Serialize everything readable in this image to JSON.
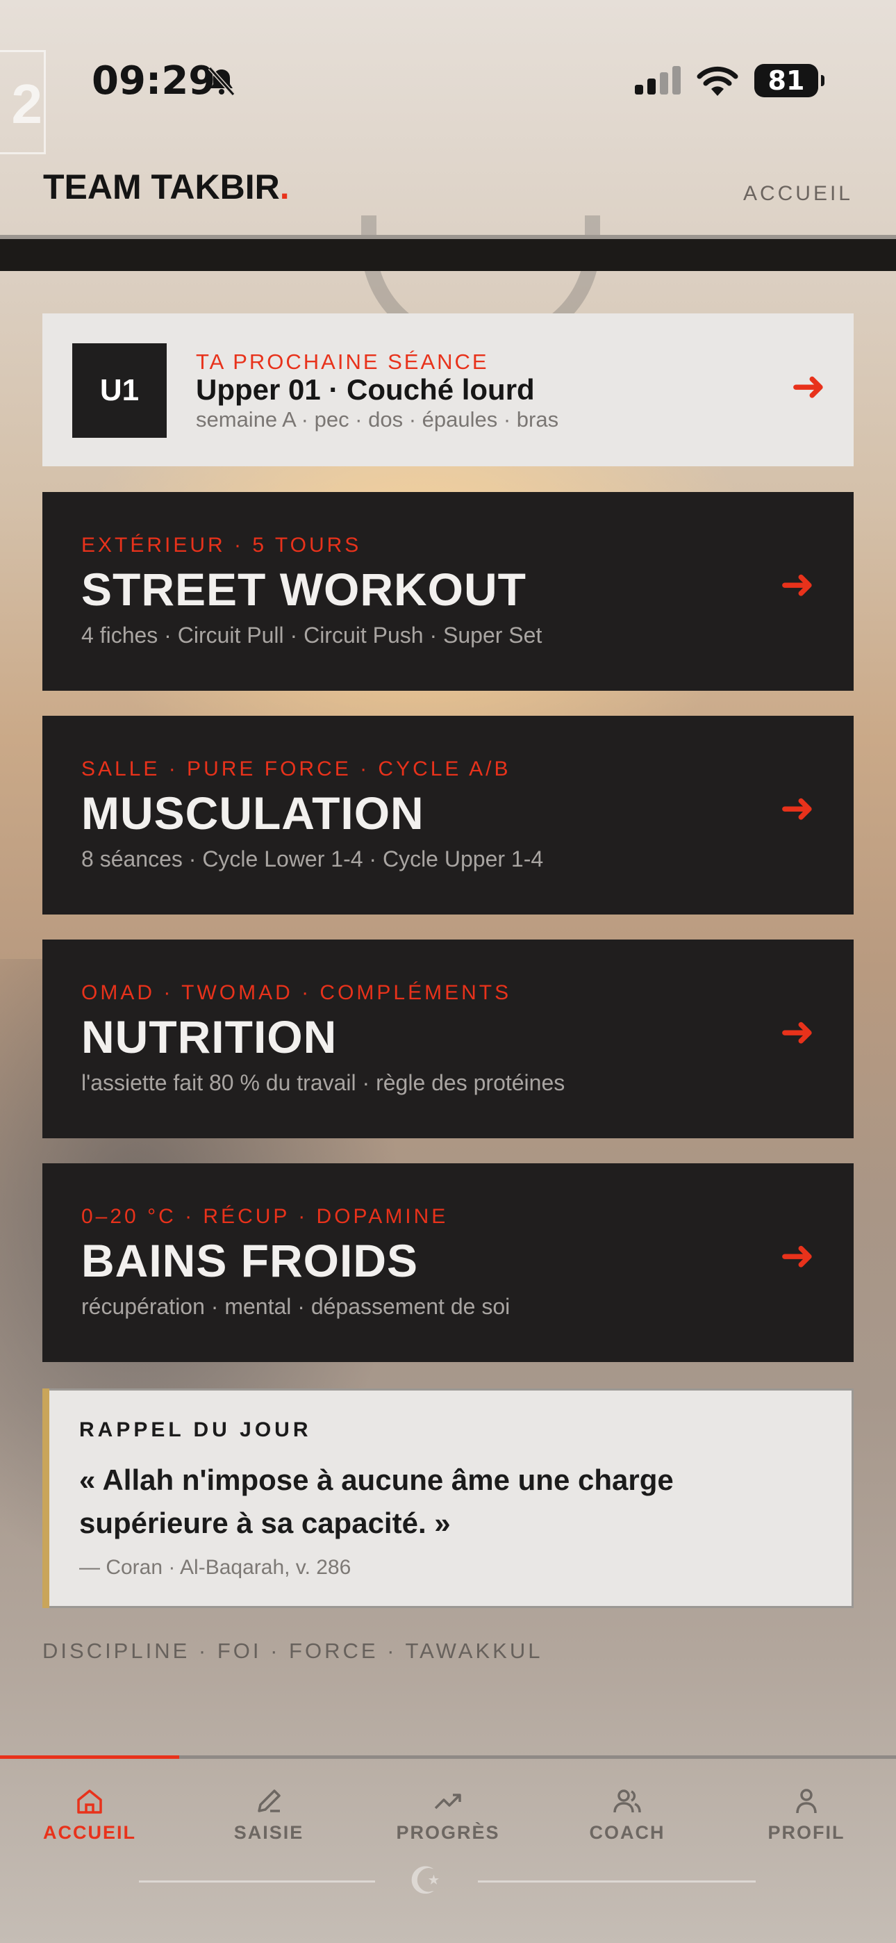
{
  "status_bar": {
    "time": "09:29",
    "battery": "81"
  },
  "background": {
    "side_number": "2"
  },
  "header": {
    "brand": "TEAM TAKBIR",
    "brand_dot": ".",
    "nav": "ACCUEIL"
  },
  "next_session": {
    "badge": "U1",
    "kicker": "TA PROCHAINE SÉANCE",
    "title": "Upper 01 · Couché lourd",
    "subtitle": "semaine A · pec · dos · épaules · bras",
    "arrow": "➜"
  },
  "cards": [
    {
      "kicker": "EXTÉRIEUR · 5 TOURS",
      "title": "STREET WORKOUT",
      "subtitle": "4 fiches · Circuit Pull · Circuit Push · Super Set",
      "arrow": "➜"
    },
    {
      "kicker": "SALLE · PURE FORCE · CYCLE A/B",
      "title": "MUSCULATION",
      "subtitle": "8 séances · Cycle Lower 1-4 · Cycle Upper 1-4",
      "arrow": "➜"
    },
    {
      "kicker": "OMAD · TWOMAD · COMPLÉMENTS",
      "title": "NUTRITION",
      "subtitle": "l'assiette fait 80 % du travail · règle des protéines",
      "arrow": "➜"
    },
    {
      "kicker": "0–20 °C · RÉCUP · DOPAMINE",
      "title": "BAINS FROIDS",
      "subtitle": "récupération · mental · dépassement de soi",
      "arrow": "➜"
    }
  ],
  "reminder": {
    "kicker": "RAPPEL DU JOUR",
    "quote": "« Allah n'impose à aucune âme une charge supérieure à sa capacité. »",
    "source": "— Coran · Al-Baqarah, v. 286"
  },
  "motto": "DISCIPLINE · FOI · FORCE · TAWAKKUL",
  "tabs": [
    {
      "label": "ACCUEIL",
      "icon": "home-icon"
    },
    {
      "label": "SAISIE",
      "icon": "pencil-icon"
    },
    {
      "label": "PROGRÈS",
      "icon": "trend-up-icon"
    },
    {
      "label": "COACH",
      "icon": "users-icon"
    },
    {
      "label": "PROFIL",
      "icon": "user-icon"
    }
  ],
  "colors": {
    "accent": "#e8321b",
    "dark_card": "#201e1e",
    "light_card": "#e9e7e5",
    "quote_bar": "#c9a55a"
  }
}
